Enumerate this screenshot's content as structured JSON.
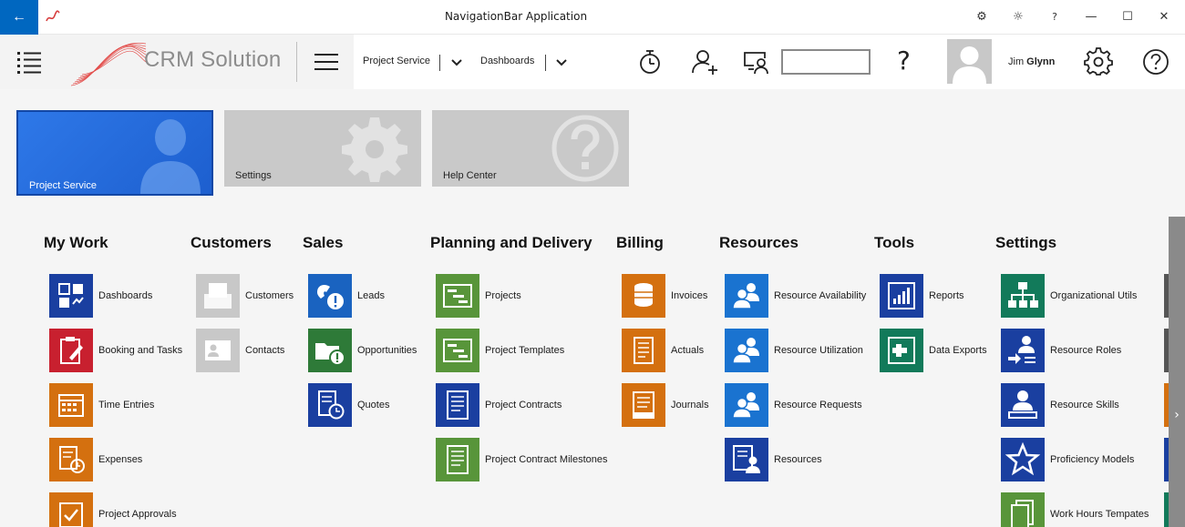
{
  "window": {
    "title": "NavigationBar Application",
    "back_glyph": "←",
    "controls": {
      "settings_glyph": "⚙",
      "theme_glyph": "☼",
      "help_glyph": "?",
      "minimize_glyph": "—",
      "maximize_glyph": "☐",
      "close_glyph": "✕"
    }
  },
  "navbar": {
    "logo_text": "CRM Solution",
    "menus": [
      {
        "label": "Project Service"
      },
      {
        "label": "Dashboards"
      }
    ],
    "search": {
      "value": "",
      "placeholder": ""
    },
    "help_glyph": "?",
    "user": {
      "first": "Jim",
      "last": "Glynn"
    }
  },
  "tiles": [
    {
      "label": "Project Service",
      "icon": "user-icon",
      "active": true
    },
    {
      "label": "Settings",
      "icon": "gear-icon",
      "active": false
    },
    {
      "label": "Help Center",
      "icon": "question-icon",
      "active": false
    }
  ],
  "groups": [
    {
      "title": "My Work",
      "items": [
        {
          "label": "Dashboards",
          "color": "#1a3fa0",
          "icon": "dashboard-icon"
        },
        {
          "label": "Booking and Tasks",
          "color": "#c8202f",
          "icon": "clipboard-edit-icon"
        },
        {
          "label": "Time Entries",
          "color": "#d4700f",
          "icon": "calendar-icon"
        },
        {
          "label": "Expenses",
          "color": "#d4700f",
          "icon": "expense-clock-icon"
        },
        {
          "label": "Project Approvals",
          "color": "#d4700f",
          "icon": "approval-check-icon"
        }
      ]
    },
    {
      "title": "Customers",
      "items": [
        {
          "label": "Customers",
          "color": "#c8c8c8",
          "icon": "customer-card-icon"
        },
        {
          "label": "Contacts",
          "color": "#c8c8c8",
          "icon": "contact-card-icon"
        }
      ]
    },
    {
      "title": "Sales",
      "items": [
        {
          "label": "Leads",
          "color": "#1a63c0",
          "icon": "phone-alert-icon"
        },
        {
          "label": "Opportunities",
          "color": "#2e7a38",
          "icon": "folder-alert-icon"
        },
        {
          "label": "Quotes",
          "color": "#1a3fa0",
          "icon": "document-clock-icon"
        }
      ]
    },
    {
      "title": "Planning and Delivery",
      "items": [
        {
          "label": "Projects",
          "color": "#58953a",
          "icon": "project-gantt-icon"
        },
        {
          "label": "Project Templates",
          "color": "#58953a",
          "icon": "project-template-icon"
        },
        {
          "label": "Project Contracts",
          "color": "#1a3fa0",
          "icon": "contract-document-icon"
        },
        {
          "label": "Project Contract Milestones",
          "color": "#58953a",
          "icon": "milestone-document-icon"
        }
      ]
    },
    {
      "title": "Billing",
      "items": [
        {
          "label": "Invoices",
          "color": "#d4700f",
          "icon": "invoice-coins-icon"
        },
        {
          "label": "Actuals",
          "color": "#d4700f",
          "icon": "actuals-document-icon"
        },
        {
          "label": "Journals",
          "color": "#d4700f",
          "icon": "journal-icon"
        }
      ]
    },
    {
      "title": "Resources",
      "items": [
        {
          "label": "Resource Availability",
          "color": "#1a73d0",
          "icon": "people-icon"
        },
        {
          "label": "Resource Utilization",
          "color": "#1a73d0",
          "icon": "people-icon"
        },
        {
          "label": "Resource Requests",
          "color": "#1a73d0",
          "icon": "people-icon"
        },
        {
          "label": "Resources",
          "color": "#1a3fa0",
          "icon": "resource-list-icon"
        }
      ]
    },
    {
      "title": "Tools",
      "items": [
        {
          "label": "Reports",
          "color": "#1a3fa0",
          "icon": "report-chart-icon"
        },
        {
          "label": "Data Exports",
          "color": "#127a5a",
          "icon": "data-export-icon"
        }
      ]
    },
    {
      "title": "Settings",
      "items": [
        {
          "label": "Organizational Utils",
          "color": "#127a5a",
          "icon": "org-chart-icon"
        },
        {
          "label": "Resource Roles",
          "color": "#1a3fa0",
          "icon": "role-arrow-icon"
        },
        {
          "label": "Resource Skills",
          "color": "#1a3fa0",
          "icon": "skill-person-icon"
        },
        {
          "label": "Proficiency Models",
          "color": "#1a3fa0",
          "icon": "star-icon"
        },
        {
          "label": "Work Hours Tempates",
          "color": "#58953a",
          "icon": "template-pages-icon"
        }
      ]
    }
  ],
  "peek_colors": [
    "#555555",
    "#555555",
    "#d4700f",
    "#1a3fa0",
    "#127a5a"
  ]
}
